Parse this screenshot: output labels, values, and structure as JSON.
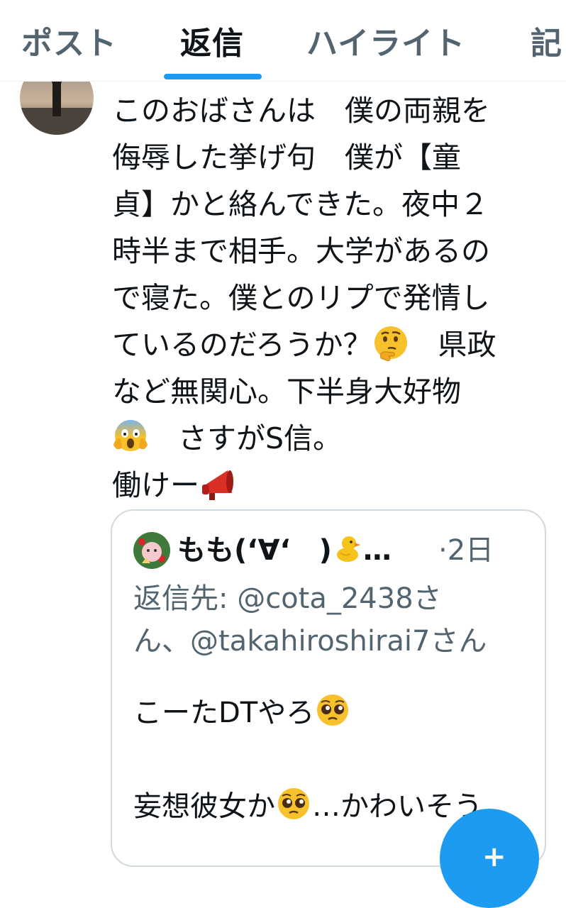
{
  "tabs": [
    {
      "label": "ポスト",
      "active": false
    },
    {
      "label": "返信",
      "active": true
    },
    {
      "label": "ハイライト",
      "active": false
    },
    {
      "label": "記",
      "active": false
    }
  ],
  "post": {
    "lines": [
      "このおばさんは　僕の両親を",
      "侮辱した挙げ句　僕が【童",
      "貞】かと絡んできた。夜中２",
      "時半まで相手。大学があるの",
      "で寝た。僕とのリプで発情し",
      "ているのだろうか？",
      "　県政",
      "など無関心。下半身大好物",
      "　さすがS信。",
      "働けー"
    ],
    "emojis": [
      "thinking-face",
      "screaming-face",
      "megaphone"
    ]
  },
  "quote": {
    "author_name": "もも(‘∀‘　)",
    "author_name_suffix": "…",
    "time_sep": "·",
    "time": "2日",
    "reply_lines": [
      "返信先: @cota_2438さ",
      "ん、@takahiroshirai7さん"
    ],
    "body_line1": "こーたDTやろ",
    "body_line2_a": "妄想彼女か",
    "body_line2_b": "…かわいそう",
    "emojis": [
      "chick",
      "pleading-face"
    ]
  },
  "fab": {
    "label": "+"
  },
  "colors": {
    "accent": "#1d9bf0",
    "text": "#0f1419",
    "muted": "#536471",
    "border": "#cfd9de"
  }
}
